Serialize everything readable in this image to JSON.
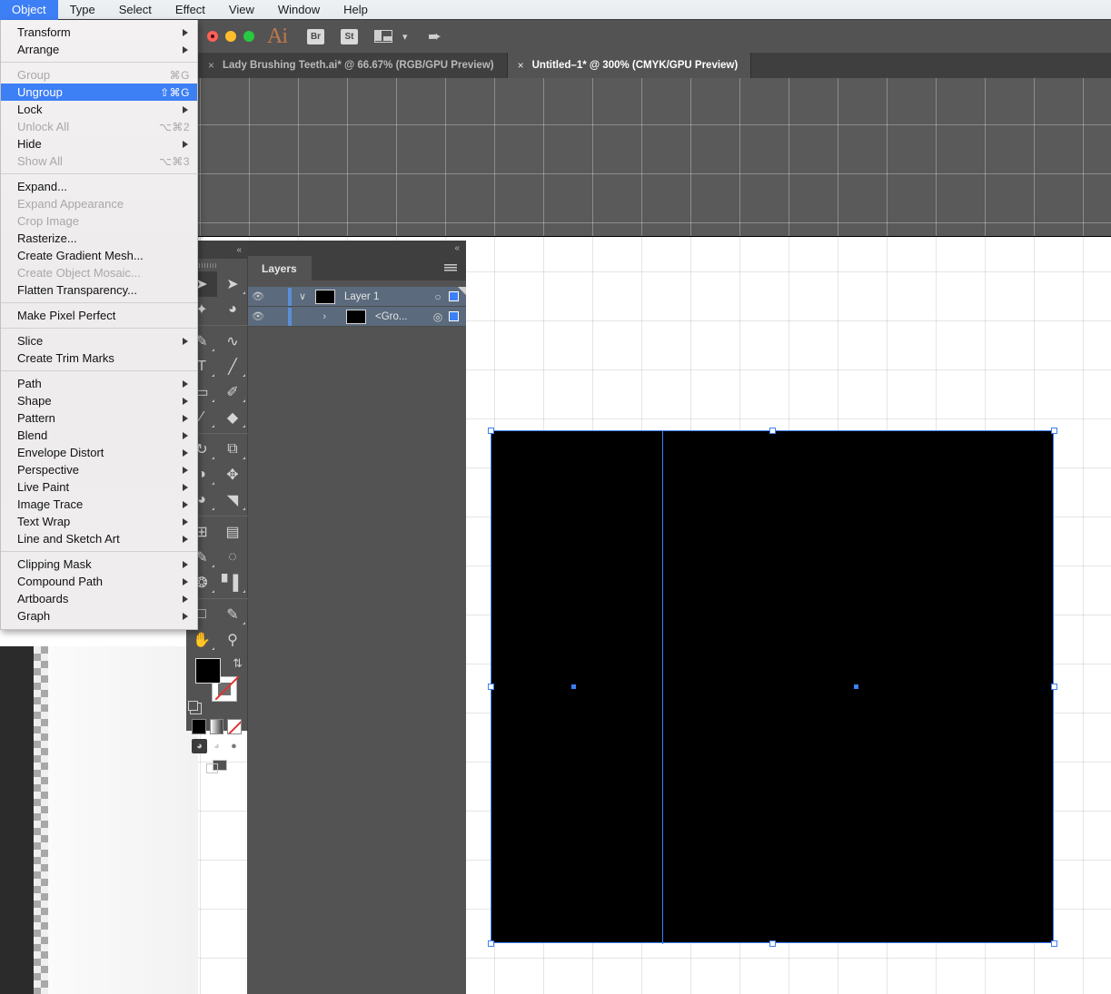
{
  "menubar": {
    "items": [
      {
        "label": "Object",
        "active": true
      },
      {
        "label": "Type",
        "active": false
      },
      {
        "label": "Select",
        "active": false
      },
      {
        "label": "Effect",
        "active": false
      },
      {
        "label": "View",
        "active": false
      },
      {
        "label": "Window",
        "active": false
      },
      {
        "label": "Help",
        "active": false
      }
    ]
  },
  "object_menu": {
    "groups": [
      {
        "items": [
          {
            "label": "Transform",
            "shortcut": "",
            "submenu": true,
            "disabled": false,
            "highlighted": false
          },
          {
            "label": "Arrange",
            "shortcut": "",
            "submenu": true,
            "disabled": false,
            "highlighted": false
          }
        ]
      },
      {
        "items": [
          {
            "label": "Group",
            "shortcut": "⌘G",
            "submenu": false,
            "disabled": true,
            "highlighted": false
          },
          {
            "label": "Ungroup",
            "shortcut": "⇧⌘G",
            "submenu": false,
            "disabled": false,
            "highlighted": true
          },
          {
            "label": "Lock",
            "shortcut": "",
            "submenu": true,
            "disabled": false,
            "highlighted": false
          },
          {
            "label": "Unlock All",
            "shortcut": "⌥⌘2",
            "submenu": false,
            "disabled": true,
            "highlighted": false
          },
          {
            "label": "Hide",
            "shortcut": "",
            "submenu": true,
            "disabled": false,
            "highlighted": false
          },
          {
            "label": "Show All",
            "shortcut": "⌥⌘3",
            "submenu": false,
            "disabled": true,
            "highlighted": false
          }
        ]
      },
      {
        "items": [
          {
            "label": "Expand...",
            "shortcut": "",
            "submenu": false,
            "disabled": false,
            "highlighted": false
          },
          {
            "label": "Expand Appearance",
            "shortcut": "",
            "submenu": false,
            "disabled": true,
            "highlighted": false
          },
          {
            "label": "Crop Image",
            "shortcut": "",
            "submenu": false,
            "disabled": true,
            "highlighted": false
          },
          {
            "label": "Rasterize...",
            "shortcut": "",
            "submenu": false,
            "disabled": false,
            "highlighted": false
          },
          {
            "label": "Create Gradient Mesh...",
            "shortcut": "",
            "submenu": false,
            "disabled": false,
            "highlighted": false
          },
          {
            "label": "Create Object Mosaic...",
            "shortcut": "",
            "submenu": false,
            "disabled": true,
            "highlighted": false
          },
          {
            "label": "Flatten Transparency...",
            "shortcut": "",
            "submenu": false,
            "disabled": false,
            "highlighted": false
          }
        ]
      },
      {
        "items": [
          {
            "label": "Make Pixel Perfect",
            "shortcut": "",
            "submenu": false,
            "disabled": false,
            "highlighted": false
          }
        ]
      },
      {
        "items": [
          {
            "label": "Slice",
            "shortcut": "",
            "submenu": true,
            "disabled": false,
            "highlighted": false
          },
          {
            "label": "Create Trim Marks",
            "shortcut": "",
            "submenu": false,
            "disabled": false,
            "highlighted": false
          }
        ]
      },
      {
        "items": [
          {
            "label": "Path",
            "shortcut": "",
            "submenu": true,
            "disabled": false,
            "highlighted": false
          },
          {
            "label": "Shape",
            "shortcut": "",
            "submenu": true,
            "disabled": false,
            "highlighted": false
          },
          {
            "label": "Pattern",
            "shortcut": "",
            "submenu": true,
            "disabled": false,
            "highlighted": false
          },
          {
            "label": "Blend",
            "shortcut": "",
            "submenu": true,
            "disabled": false,
            "highlighted": false
          },
          {
            "label": "Envelope Distort",
            "shortcut": "",
            "submenu": true,
            "disabled": false,
            "highlighted": false
          },
          {
            "label": "Perspective",
            "shortcut": "",
            "submenu": true,
            "disabled": false,
            "highlighted": false
          },
          {
            "label": "Live Paint",
            "shortcut": "",
            "submenu": true,
            "disabled": false,
            "highlighted": false
          },
          {
            "label": "Image Trace",
            "shortcut": "",
            "submenu": true,
            "disabled": false,
            "highlighted": false
          },
          {
            "label": "Text Wrap",
            "shortcut": "",
            "submenu": true,
            "disabled": false,
            "highlighted": false
          },
          {
            "label": "Line and Sketch Art",
            "shortcut": "",
            "submenu": true,
            "disabled": false,
            "highlighted": false
          }
        ]
      },
      {
        "items": [
          {
            "label": "Clipping Mask",
            "shortcut": "",
            "submenu": true,
            "disabled": false,
            "highlighted": false
          },
          {
            "label": "Compound Path",
            "shortcut": "",
            "submenu": true,
            "disabled": false,
            "highlighted": false
          },
          {
            "label": "Artboards",
            "shortcut": "",
            "submenu": true,
            "disabled": false,
            "highlighted": false
          },
          {
            "label": "Graph",
            "shortcut": "",
            "submenu": true,
            "disabled": false,
            "highlighted": false
          }
        ]
      }
    ]
  },
  "titlebar": {
    "app_logo": "Ai",
    "bridge_badge": "Br",
    "stock_badge": "St",
    "arrange_icon": "arrange-documents-icon",
    "chevron_icon": "chevron-down-icon",
    "share_icon": "share-rocket-icon",
    "close_dot": "window-close-dot",
    "minimize_dot": "window-minimize-dot",
    "zoom_dot": "window-zoom-dot"
  },
  "tabs": [
    {
      "title": "Lady Brushing Teeth.ai* @ 66.67% (RGB/GPU Preview)",
      "active": false,
      "close": "×"
    },
    {
      "title": "Untitled–1* @ 300% (CMYK/GPU Preview)",
      "active": true,
      "close": "×"
    }
  ],
  "layers_panel": {
    "tab_label": "Layers",
    "collapse_icon": "collapse-panel-icon",
    "menu_icon": "panel-menu-icon",
    "rows": [
      {
        "name": "Layer 1",
        "eye_icon": "eye-visible-icon",
        "disclosure": "∨",
        "target_icon": "○",
        "selected": true,
        "child": false
      },
      {
        "name": "<Gro...",
        "eye_icon": "eye-visible-icon",
        "disclosure": "›",
        "target_icon": "◎",
        "selected": true,
        "child": true
      }
    ]
  },
  "tools_panel": {
    "collapse_icon": "collapse-panel-icon",
    "grip_icon": "panel-grip-icon",
    "tools": [
      {
        "name": "selection-tool",
        "glyph": "➤",
        "selected": true,
        "has_flyout": false
      },
      {
        "name": "direct-selection-tool",
        "glyph": "➤",
        "selected": false,
        "has_flyout": true
      },
      {
        "name": "magic-wand-tool",
        "glyph": "✦",
        "selected": false,
        "has_flyout": false
      },
      {
        "name": "lasso-tool",
        "glyph": "◔",
        "selected": false,
        "has_flyout": false
      },
      {
        "name": "pen-tool",
        "glyph": "✒",
        "selected": false,
        "has_flyout": true
      },
      {
        "name": "curvature-tool",
        "glyph": "∿",
        "selected": false,
        "has_flyout": false
      },
      {
        "name": "type-tool",
        "glyph": "T",
        "selected": false,
        "has_flyout": true
      },
      {
        "name": "line-segment-tool",
        "glyph": "╱",
        "selected": false,
        "has_flyout": true
      },
      {
        "name": "rectangle-tool",
        "glyph": "▭",
        "selected": false,
        "has_flyout": true
      },
      {
        "name": "paintbrush-tool",
        "glyph": "✐",
        "selected": false,
        "has_flyout": true
      },
      {
        "name": "shaper-tool",
        "glyph": "∕",
        "selected": false,
        "has_flyout": true
      },
      {
        "name": "eraser-tool",
        "glyph": "◆",
        "selected": false,
        "has_flyout": true
      },
      {
        "name": "rotate-tool",
        "glyph": "↻",
        "selected": false,
        "has_flyout": true
      },
      {
        "name": "scale-tool",
        "glyph": "⧉",
        "selected": false,
        "has_flyout": true
      },
      {
        "name": "width-tool",
        "glyph": "◑",
        "selected": false,
        "has_flyout": true
      },
      {
        "name": "free-transform-tool",
        "glyph": "✥",
        "selected": false,
        "has_flyout": false
      },
      {
        "name": "shape-builder-tool",
        "glyph": "◕",
        "selected": false,
        "has_flyout": true
      },
      {
        "name": "perspective-grid-tool",
        "glyph": "◥",
        "selected": false,
        "has_flyout": true
      },
      {
        "name": "mesh-tool",
        "glyph": "⊞",
        "selected": false,
        "has_flyout": false
      },
      {
        "name": "gradient-tool",
        "glyph": "▤",
        "selected": false,
        "has_flyout": false
      },
      {
        "name": "eyedropper-tool",
        "glyph": "✎",
        "selected": false,
        "has_flyout": true
      },
      {
        "name": "blend-tool",
        "glyph": "◌",
        "selected": false,
        "has_flyout": false
      },
      {
        "name": "symbol-sprayer-tool",
        "glyph": "❂",
        "selected": false,
        "has_flyout": true
      },
      {
        "name": "column-graph-tool",
        "glyph": "█",
        "selected": false,
        "has_flyout": true
      },
      {
        "name": "artboard-tool",
        "glyph": "□",
        "selected": false,
        "has_flyout": false
      },
      {
        "name": "slice-tool",
        "glyph": "✂",
        "selected": false,
        "has_flyout": true
      },
      {
        "name": "hand-tool",
        "glyph": "✋",
        "selected": false,
        "has_flyout": true
      },
      {
        "name": "zoom-tool",
        "glyph": "⚲",
        "selected": false,
        "has_flyout": false
      }
    ],
    "fill_color": "#000000",
    "stroke_color": "#ffffff",
    "swap_icon": "swap-fill-stroke-icon",
    "default_icon": "default-fill-stroke-icon",
    "color_modes": [
      {
        "name": "color-swatch-solid",
        "kind": "solid"
      },
      {
        "name": "gradient-swatch",
        "kind": "grad"
      },
      {
        "name": "none-swatch",
        "kind": "none"
      }
    ],
    "draw_modes": [
      {
        "name": "draw-normal-button",
        "glyph": "◔",
        "state": "on"
      },
      {
        "name": "draw-behind-button",
        "glyph": "◔",
        "state": "off"
      },
      {
        "name": "draw-inside-button",
        "glyph": "●",
        "state": "off"
      }
    ],
    "screen_mode": {
      "name": "screen-mode-button",
      "glyph": "screen-mode-icon"
    }
  },
  "canvas": {
    "artwork_name": "black-rectangle-artwork",
    "artwork_fill": "#000000",
    "selection_color": "#3d7ff5",
    "scratch_color": "#5a5a5a",
    "grid_visible": true
  },
  "colors": {
    "accent": "#3d7ff5",
    "panel_bg": "#535353",
    "panel_dark": "#3f3f3f",
    "menu_bg": "#eeecec"
  }
}
